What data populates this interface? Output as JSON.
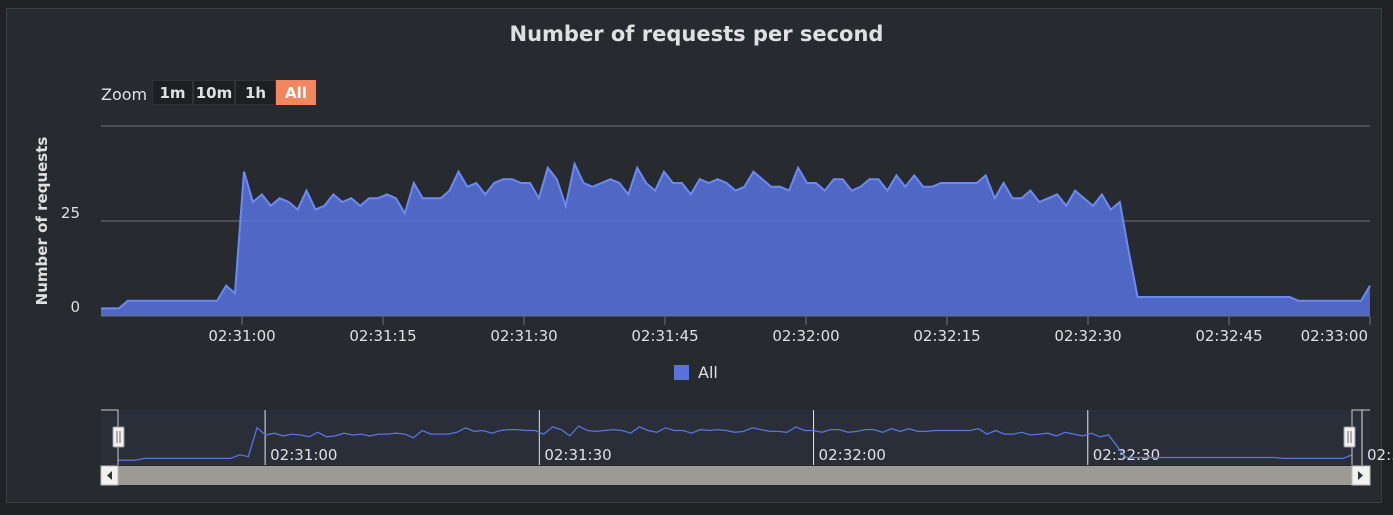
{
  "title": "Number of requests per second",
  "zoom": {
    "label": "Zoom",
    "buttons": [
      "1m",
      "10m",
      "1h",
      "All"
    ],
    "active": "All"
  },
  "legend": "All",
  "colors": {
    "series": "#5873de",
    "navigator": "#5873de",
    "active_button": "#f2875f"
  },
  "navigator_labels": [
    "02:31:00",
    "02:31:30",
    "02:32:00",
    "02:32:30",
    "02:…"
  ],
  "chart_data": {
    "type": "area",
    "title": "Number of requests per second",
    "ylabel": "Number of requests",
    "xlabel": "",
    "ylim": [
      0,
      50
    ],
    "yticks": [
      "0",
      "25"
    ],
    "xticks": [
      "02:31:00",
      "02:31:15",
      "02:31:30",
      "02:31:45",
      "02:32:00",
      "02:32:15",
      "02:32:30",
      "02:32:45",
      "02:33:00"
    ],
    "x_start": "02:30:45",
    "x_end": "02:33:00",
    "legend_position": "bottom-center",
    "grid": true,
    "series": [
      {
        "name": "All",
        "values": [
          2,
          2,
          2,
          4,
          4,
          4,
          4,
          4,
          4,
          4,
          4,
          4,
          4,
          4,
          8,
          6,
          38,
          30,
          32,
          29,
          31,
          30,
          28,
          33,
          28,
          29,
          32,
          30,
          31,
          29,
          31,
          31,
          32,
          31,
          27,
          35,
          31,
          31,
          31,
          33,
          38,
          34,
          35,
          32,
          35,
          36,
          36,
          35,
          35,
          31,
          39,
          36,
          29,
          40,
          35,
          34,
          35,
          36,
          35,
          32,
          39,
          35,
          33,
          38,
          35,
          35,
          32,
          36,
          35,
          36,
          35,
          33,
          34,
          38,
          36,
          34,
          34,
          33,
          39,
          35,
          35,
          33,
          36,
          36,
          33,
          34,
          36,
          36,
          33,
          37,
          34,
          37,
          34,
          34,
          35,
          35,
          35,
          35,
          35,
          37,
          31,
          35,
          31,
          31,
          33,
          30,
          31,
          32,
          29,
          33,
          31,
          29,
          32,
          28,
          30,
          17,
          5,
          5,
          5,
          5,
          5,
          5,
          5,
          5,
          5,
          5,
          5,
          5,
          5,
          5,
          5,
          5,
          5,
          5,
          4,
          4,
          4,
          4,
          4,
          4,
          4,
          4,
          8
        ]
      }
    ]
  }
}
